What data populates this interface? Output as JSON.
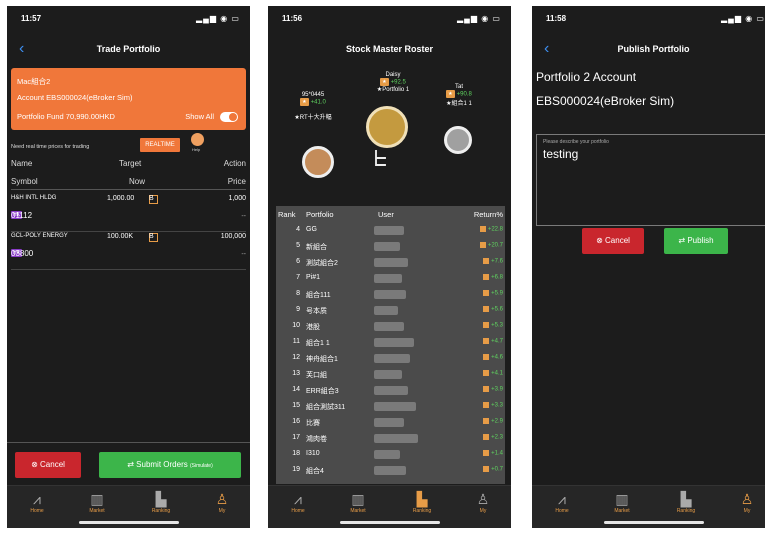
{
  "screen1": {
    "time": "11:57",
    "title": "Trade Portfolio",
    "account": {
      "name": "Mac組合2",
      "line2": "Account EBS000024(eBroker Sim)",
      "line3": "Portfolio Fund 70,990.00HKD",
      "show_all": "Show All"
    },
    "realtime_note": "Need real time prices for trading",
    "realtime_btn": "REALTIME",
    "help": "Help",
    "headers": {
      "name": "Name",
      "target": "Target",
      "action": "Action",
      "symbol": "Symbol",
      "now": "Now",
      "price": "Price"
    },
    "stocks": [
      {
        "name": "H&H INTL HLDG",
        "target": "1,000.00",
        "qty_suffix": "B",
        "price": "1,000",
        "tag": "HK",
        "code": "01112",
        "now": "--"
      },
      {
        "name": "GCL-POLY ENERGY",
        "target": "100.00K",
        "qty_suffix": "B",
        "price": "100,000",
        "tag": "HK",
        "code": "03800",
        "now": "--"
      }
    ],
    "cancel": "Cancel",
    "submit": "Submit Orders",
    "submit_tag": "(Simulate)"
  },
  "screen2": {
    "time": "11:56",
    "title": "Stock Master Roster",
    "podium": {
      "first": {
        "name": "Daisy",
        "ret": "+92.5",
        "portfolio": "Portfolio 1"
      },
      "second": {
        "name": "95*0445",
        "ret": "+41.0",
        "portfolio": "RT十大升幅"
      },
      "third": {
        "name": "Tat",
        "ret": "+90.8",
        "portfolio": "組合1 1"
      }
    },
    "headers": {
      "rank": "Rank",
      "portfolio": "Portfolio",
      "user": "User",
      "return": "Return%"
    },
    "rows": [
      {
        "rank": "4",
        "portfolio": "GG",
        "ret": "+22.8"
      },
      {
        "rank": "5",
        "portfolio": "新組合",
        "ret": "+20.7"
      },
      {
        "rank": "6",
        "portfolio": "測試組合2",
        "ret": "+7.6"
      },
      {
        "rank": "7",
        "portfolio": "Pi#1",
        "ret": "+6.8"
      },
      {
        "rank": "8",
        "portfolio": "組合111",
        "ret": "+5.9"
      },
      {
        "rank": "9",
        "portfolio": "号本质",
        "ret": "+5.6"
      },
      {
        "rank": "10",
        "portfolio": "港股",
        "ret": "+5.3"
      },
      {
        "rank": "11",
        "portfolio": "組合1 1",
        "ret": "+4.7"
      },
      {
        "rank": "12",
        "portfolio": "神舟組合1",
        "ret": "+4.6"
      },
      {
        "rank": "13",
        "portfolio": "芙口組",
        "ret": "+4.1"
      },
      {
        "rank": "14",
        "portfolio": "ERR組合3",
        "ret": "+3.9"
      },
      {
        "rank": "15",
        "portfolio": "組合測試311",
        "ret": "+3.3"
      },
      {
        "rank": "16",
        "portfolio": "比賽",
        "ret": "+2.9"
      },
      {
        "rank": "17",
        "portfolio": "鴻肉卷",
        "ret": "+2.3"
      },
      {
        "rank": "18",
        "portfolio": "I310",
        "ret": "+1.4"
      },
      {
        "rank": "19",
        "portfolio": "組合4",
        "ret": "+0.7"
      }
    ]
  },
  "screen3": {
    "time": "11:58",
    "title": "Publish Portfolio",
    "line1": "Portfolio 2 Account",
    "line2": "EBS000024(eBroker Sim)",
    "placeholder": "Please describe your portfolio",
    "value": "testing",
    "cancel": "Cancel",
    "publish": "Publish"
  },
  "tabs": [
    "Home",
    "Market",
    "Ranking",
    "My"
  ]
}
